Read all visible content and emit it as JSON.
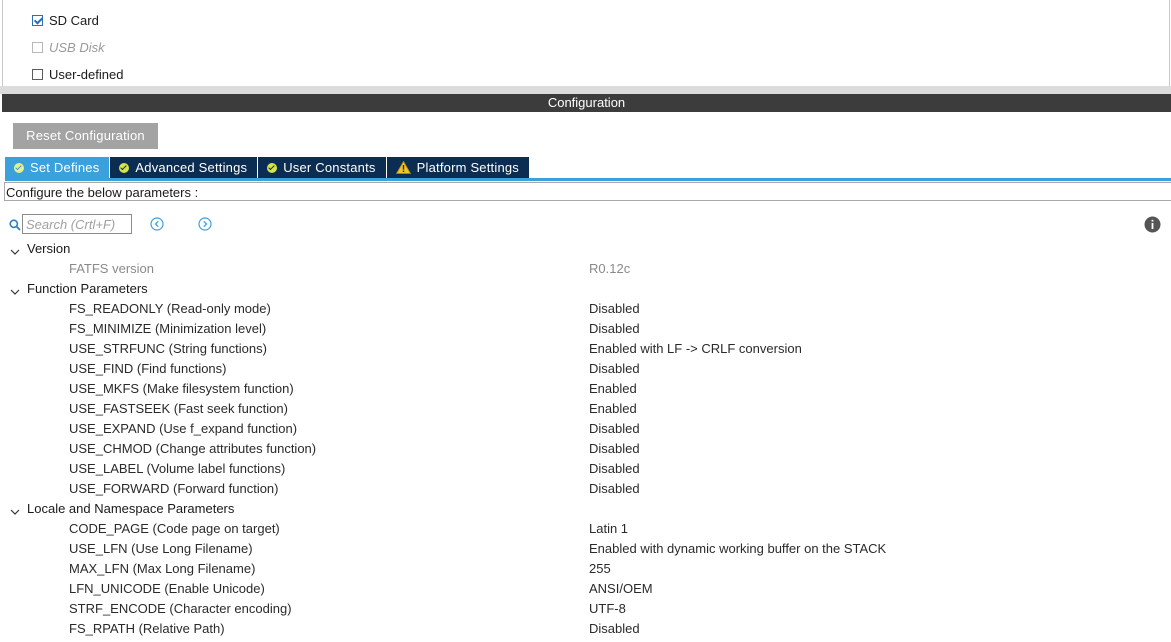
{
  "mode": {
    "options": [
      {
        "label": "SD Card",
        "checked": true,
        "disabled": false
      },
      {
        "label": "USB Disk",
        "checked": false,
        "disabled": true
      },
      {
        "label": "User-defined",
        "checked": false,
        "disabled": false
      }
    ]
  },
  "configuration": {
    "title": "Configuration",
    "reset_label": "Reset Configuration",
    "tabs": [
      {
        "label": "Set Defines",
        "icon": "check-circle-icon",
        "active": true
      },
      {
        "label": "Advanced Settings",
        "icon": "check-circle-icon",
        "active": false
      },
      {
        "label": "User Constants",
        "icon": "check-circle-icon",
        "active": false
      },
      {
        "label": "Platform Settings",
        "icon": "warning-icon",
        "active": false
      }
    ],
    "instructions": "Configure the below parameters :",
    "search": {
      "placeholder": "Search (Crtl+F)",
      "value": ""
    },
    "groups": [
      {
        "label": "Version",
        "params": [
          {
            "name": "FATFS version",
            "value": "R0.12c",
            "readonly": true
          }
        ]
      },
      {
        "label": "Function Parameters",
        "params": [
          {
            "name": "FS_READONLY (Read-only mode)",
            "value": "Disabled"
          },
          {
            "name": "FS_MINIMIZE (Minimization level)",
            "value": "Disabled"
          },
          {
            "name": "USE_STRFUNC (String functions)",
            "value": "Enabled with LF -> CRLF conversion"
          },
          {
            "name": "USE_FIND (Find functions)",
            "value": "Disabled"
          },
          {
            "name": "USE_MKFS (Make filesystem function)",
            "value": "Enabled"
          },
          {
            "name": "USE_FASTSEEK (Fast seek function)",
            "value": "Enabled"
          },
          {
            "name": "USE_EXPAND (Use f_expand function)",
            "value": "Disabled"
          },
          {
            "name": "USE_CHMOD (Change attributes function)",
            "value": "Disabled"
          },
          {
            "name": "USE_LABEL (Volume label functions)",
            "value": "Disabled"
          },
          {
            "name": "USE_FORWARD (Forward function)",
            "value": "Disabled"
          }
        ]
      },
      {
        "label": "Locale and Namespace Parameters",
        "params": [
          {
            "name": "CODE_PAGE (Code page on target)",
            "value": "Latin 1"
          },
          {
            "name": "USE_LFN (Use Long Filename)",
            "value": "Enabled with dynamic working buffer on the STACK"
          },
          {
            "name": "MAX_LFN (Max Long Filename)",
            "value": "255"
          },
          {
            "name": "LFN_UNICODE (Enable Unicode)",
            "value": "ANSI/OEM"
          },
          {
            "name": "STRF_ENCODE (Character encoding)",
            "value": "UTF-8"
          },
          {
            "name": "FS_RPATH (Relative Path)",
            "value": "Disabled"
          }
        ]
      }
    ]
  },
  "colors": {
    "header_bar": "#3c3c3c",
    "tab_active": "#3aa1dc",
    "tab_inactive": "#0b2d52",
    "ok_icon": "#d7e34a",
    "warning_icon": "#f2c12e",
    "reset_button": "#a3a3a3"
  }
}
